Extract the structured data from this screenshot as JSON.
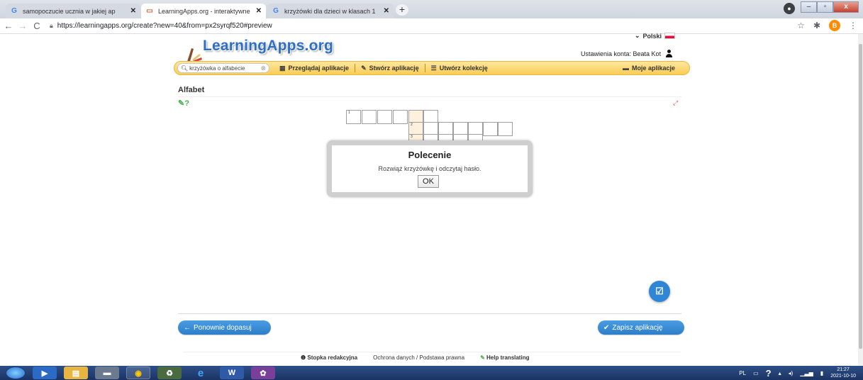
{
  "browser": {
    "tabs": [
      {
        "title": "samopoczucie ucznia w jakiej ap",
        "icon": "google-icon",
        "active": false
      },
      {
        "title": "LearningApps.org - interaktywne",
        "icon": "learningapps-icon",
        "active": true
      },
      {
        "title": "krzyżówki dla dzieci w klasach 1",
        "icon": "google-icon",
        "active": false
      }
    ],
    "url": "https://learningapps.org/create?new=40&from=px2syrqf520#preview",
    "profile_initial": "B"
  },
  "header": {
    "logo_text": "LearningApps.org",
    "language": "Polski",
    "account_label": "Ustawienia konta: Beata Kot"
  },
  "menu": {
    "search_value": "krzyżówka o alfabecie",
    "browse_label": "Przeglądaj aplikacje",
    "create_label": "Stwórz aplikację",
    "collection_label": "Utwórz kolekcję",
    "my_apps_label": "Moje aplikacje"
  },
  "app": {
    "title": "Alfabet"
  },
  "crossword": {
    "clue_numbers": [
      "1",
      "2",
      "3"
    ]
  },
  "dialog": {
    "title": "Polecenie",
    "text": "Rozwiąż krzyżówkę i odczytaj hasło.",
    "ok_label": "OK"
  },
  "actions": {
    "refit_label": "Ponownie dopasuj",
    "save_label": "Zapisz aplikację"
  },
  "footer": {
    "imprint_label": "Stopka redakcyjna",
    "privacy_label": "Ochrona danych / Podstawa prawna",
    "help_label": "Help translating"
  },
  "taskbar": {
    "language": "PL",
    "time": "21:27",
    "date": "2021-10-10"
  },
  "colors": {
    "menu_bar": "#f9cd54",
    "logo_blue": "#2e6fc6",
    "button_blue": "#2d7ec9",
    "highlight_cell": "#fdf1de"
  }
}
